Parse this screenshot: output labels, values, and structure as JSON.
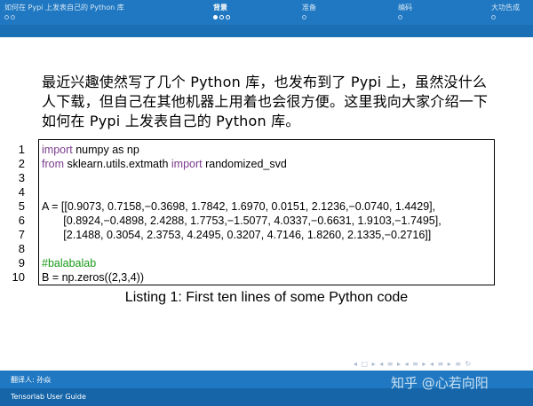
{
  "nav": {
    "sections": [
      {
        "label": "如何在 Pypi 上发表自己的 Python 库",
        "active": false,
        "dots": [
          false,
          false
        ]
      },
      {
        "label": "背景",
        "active": true,
        "dots": [
          true,
          false,
          false
        ]
      },
      {
        "label": "准备",
        "active": false,
        "dots": [
          false
        ]
      },
      {
        "label": "编码",
        "active": false,
        "dots": [
          false
        ]
      },
      {
        "label": "大功告成",
        "active": false,
        "dots": [
          false
        ]
      }
    ]
  },
  "body": {
    "paragraph": "最近兴趣使然写了几个 Python 库，也发布到了 Pypi 上，虽然没什么人下载，但自己在其他机器上用着也会很方便。这里我向大家介绍一下如何在 Pypi 上发表自己的 Python 库。"
  },
  "listing": {
    "lines": [
      {
        "n": "1",
        "parts": [
          {
            "t": "import",
            "c": "kw"
          },
          {
            "t": " numpy as np",
            "c": ""
          }
        ]
      },
      {
        "n": "2",
        "parts": [
          {
            "t": "from",
            "c": "kw"
          },
          {
            "t": " sklearn.utils.extmath ",
            "c": ""
          },
          {
            "t": "import",
            "c": "kw"
          },
          {
            "t": " randomized_svd",
            "c": ""
          }
        ]
      },
      {
        "n": "3",
        "parts": []
      },
      {
        "n": "4",
        "parts": []
      },
      {
        "n": "5",
        "parts": [
          {
            "t": "A = [[0.9073, 0.7158,−0.3698, 1.7842, 1.6970, 0.0151, 2.1236,−0.0740, 1.4429],",
            "c": ""
          }
        ]
      },
      {
        "n": "6",
        "parts": [
          {
            "t": "       [0.8924,−0.4898, 2.4288, 1.7753,−1.5077, 4.0337,−0.6631, 1.9103,−1.7495],",
            "c": ""
          }
        ]
      },
      {
        "n": "7",
        "parts": [
          {
            "t": "       [2.1488, 0.3054, 2.3753, 4.2495, 0.3207, 4.7146, 1.8260, 2.1335,−0.2716]]",
            "c": ""
          }
        ]
      },
      {
        "n": "8",
        "parts": []
      },
      {
        "n": "9",
        "parts": [
          {
            "t": "#balabalab",
            "c": "cm"
          }
        ]
      },
      {
        "n": "10",
        "parts": [
          {
            "t": "B = np.zeros((2,3,4))",
            "c": ""
          }
        ]
      }
    ],
    "caption": "Listing 1: First ten lines of some Python code"
  },
  "nav_symbols": "◂ ▢ ▸  ◂ ≡ ▸  ◂ ≡ ▸  ◂ ≡ ▸   ≡  ↻",
  "footer": {
    "translator": "翻译人: 孙焱",
    "title": "Tensorlab User Guide",
    "watermark": "知乎 @心若向阳"
  },
  "colors": {
    "bar": "#1f78c1",
    "keyword": "#7a3b8c",
    "comment": "#1a9a1a"
  }
}
